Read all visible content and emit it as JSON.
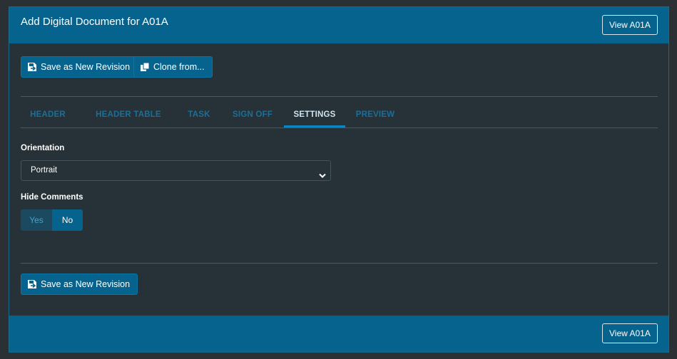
{
  "header": {
    "title": "Add Digital Document for A01A",
    "view_button": "View A01A"
  },
  "toolbar": {
    "save_label": "Save as New Revision",
    "clone_label": "Clone from..."
  },
  "tabs": [
    {
      "label": "HEADER",
      "active": false
    },
    {
      "label": "HEADER TABLE",
      "active": false
    },
    {
      "label": "TASK",
      "active": false
    },
    {
      "label": "SIGN OFF",
      "active": false
    },
    {
      "label": "SETTINGS",
      "active": true
    },
    {
      "label": "PREVIEW",
      "active": false
    }
  ],
  "settings": {
    "orientation_label": "Orientation",
    "orientation_value": "Portrait",
    "hide_comments_label": "Hide Comments",
    "toggle_yes": "Yes",
    "toggle_no": "No",
    "toggle_selected": "No"
  },
  "footer": {
    "save_label": "Save as New Revision",
    "view_button": "View A01A"
  },
  "icons": {
    "save": "save-revision-icon",
    "clone": "clone-icon",
    "select": "chevron-down-icon"
  },
  "colors": {
    "header_bg": "#06638e",
    "panel_bg": "#263238",
    "tab_inactive": "#1d6e97",
    "tab_underline": "#0a87c2"
  }
}
